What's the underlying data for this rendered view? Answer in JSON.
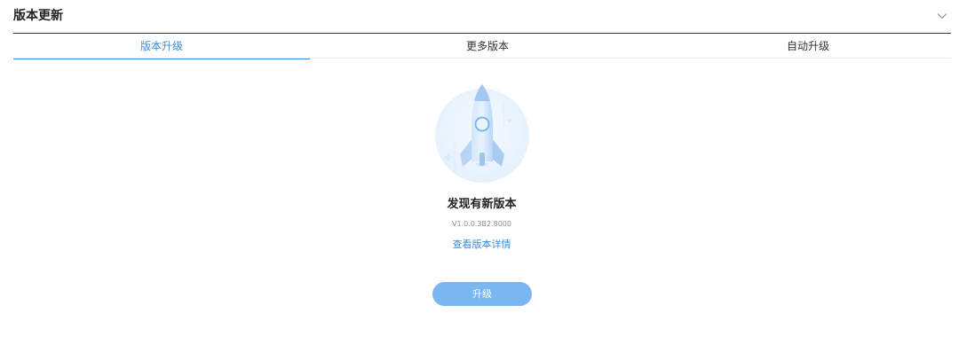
{
  "panel": {
    "title": "版本更新",
    "collapse_icon": "chevron-down-icon"
  },
  "tabs": [
    {
      "label": "版本升级",
      "active": true
    },
    {
      "label": "更多版本",
      "active": false
    },
    {
      "label": "自动升级",
      "active": false
    }
  ],
  "upgrade": {
    "illustration_icon": "rocket-icon",
    "title": "发现有新版本",
    "version": "V1.0.0.3B2.8000",
    "details_link": "查看版本详情",
    "button_label": "升级"
  },
  "colors": {
    "accent": "#3b8fe0",
    "button": "#7ab7f0",
    "header_rule": "#3a3a3a"
  }
}
